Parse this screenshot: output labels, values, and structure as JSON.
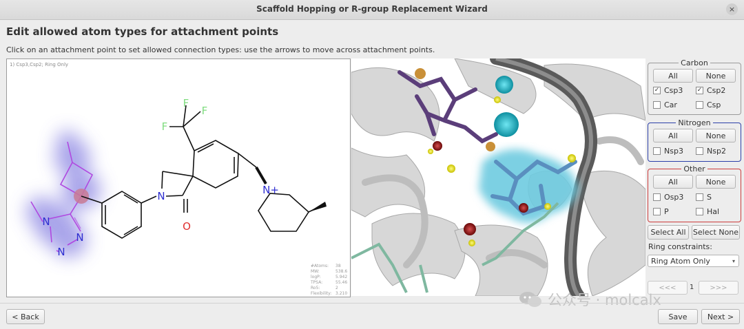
{
  "window": {
    "title": "Scaffold Hopping or R-group Replacement Wizard",
    "close_glyph": "×"
  },
  "page": {
    "heading": "Edit allowed atom types for attachment points",
    "instructions": "Click on an attachment point to set allowed connection types: use the arrows to move across attachment points."
  },
  "molecule": {
    "attachment_label": "1) Csp3,Csp2; Ring Only",
    "atoms": {
      "F1": "F",
      "F2": "F",
      "F3": "F",
      "N_lactam": "N",
      "O_lactam": "O",
      "N_pip": "N+",
      "N_methyl": "N",
      "N_tz1": "N",
      "N_tz2": "N"
    },
    "colors": {
      "fluorine": "#7fdc7f",
      "nitrogen": "#2d2dd0",
      "oxygen": "#e03030",
      "highlight_glow": "#a09ae8",
      "attachment_dot": "#c97a94",
      "highlight_bond": "#b048e0"
    },
    "properties": [
      {
        "key": "#Atoms:",
        "value": "38"
      },
      {
        "key": "MW:",
        "value": "538.6"
      },
      {
        "key": "logP:",
        "value": "5.942"
      },
      {
        "key": "TPSA:",
        "value": "55.46"
      },
      {
        "key": "Ro5:",
        "value": "2"
      },
      {
        "key": "Flexibility:",
        "value": "3.210"
      }
    ]
  },
  "groups": {
    "carbon": {
      "title": "Carbon",
      "all_label": "All",
      "none_label": "None",
      "options": [
        {
          "label": "Csp3",
          "checked": true
        },
        {
          "label": "Csp2",
          "checked": true
        },
        {
          "label": "Car",
          "checked": false
        },
        {
          "label": "Csp",
          "checked": false
        }
      ]
    },
    "nitrogen": {
      "title": "Nitrogen",
      "all_label": "All",
      "none_label": "None",
      "options": [
        {
          "label": "Nsp3",
          "checked": false
        },
        {
          "label": "Nsp2",
          "checked": false
        }
      ]
    },
    "other": {
      "title": "Other",
      "all_label": "All",
      "none_label": "None",
      "options": [
        {
          "label": "Osp3",
          "checked": false
        },
        {
          "label": "S",
          "checked": false
        },
        {
          "label": "P",
          "checked": false
        },
        {
          "label": "Hal",
          "checked": false
        }
      ]
    }
  },
  "group_colors": {
    "carbon": "#9a9a9a",
    "nitrogen": "#2b3fa8",
    "other": "#cc3b3b"
  },
  "select_all_label": "Select All",
  "select_none_label": "Select None",
  "ring_constraints": {
    "label": "Ring constraints:",
    "value": "Ring Atom Only",
    "arrow_glyph": "▾"
  },
  "pager": {
    "prev_label": "<<<",
    "page": "1",
    "next_label": ">>>"
  },
  "footer": {
    "back_label": "< Back",
    "save_label": "Save",
    "next_label": "Next >"
  },
  "watermark": {
    "text": "公众号 · molcalx"
  }
}
